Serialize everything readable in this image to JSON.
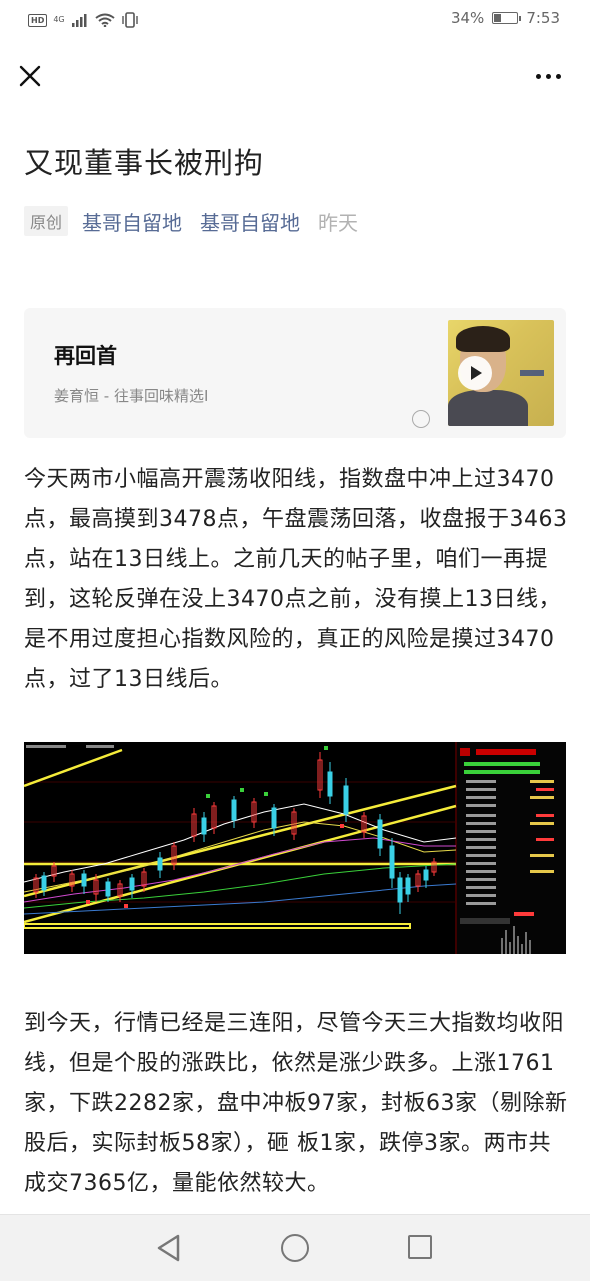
{
  "status_bar": {
    "hd": "HD",
    "network": "4G",
    "battery_percent": "34%",
    "battery_level": 0.34,
    "time": "7:53"
  },
  "article": {
    "title": "又现董事长被刑拘",
    "tag": "原创",
    "author": "基哥自留地",
    "account": "基哥自留地",
    "date": "昨天",
    "paragraph1": "今天两市小幅高开震荡收阳线，指数盘中冲上过3470点，最高摸到3478点，午盘震荡回落，收盘报于3463点，站在13日线上。之前几天的帖子里，咱们一再提到，这轮反弹在没上3470点之前，没有摸上13日线，是不用过度担心指数风险的，真正的风险是摸过3470点，过了13日线后。",
    "paragraph2": "到今天，行情已经是三连阳，尽管今天三大指数均收阳线，但是个股的涨跌比，依然是涨少跌多。上涨1761家，下跌2282家，盘中冲板97家，封板63家（剔除新股后，实际封板58家），砸 板1家，跌停3家。两市共成交7365亿，量能依然较大。"
  },
  "music": {
    "title": "再回首",
    "subtitle": "姜育恒 - 往事回味精选I"
  },
  "icons": {
    "close": "close-icon",
    "more": "more-icon",
    "play": "play-icon",
    "back": "back-triangle-icon",
    "home": "home-circle-icon",
    "recent": "recent-square-icon"
  }
}
